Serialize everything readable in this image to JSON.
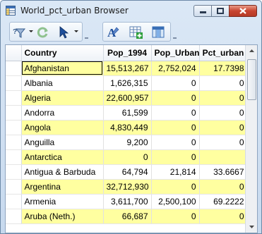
{
  "window": {
    "title": "World_pct_urban Browser",
    "icon": "table-browser-icon"
  },
  "toolbar": {
    "buttons": [
      {
        "name": "select-by-attribute-icon",
        "has_dropdown": true
      },
      {
        "name": "refresh-icon",
        "has_dropdown": false
      },
      {
        "name": "pointer-select-icon",
        "has_dropdown": true
      },
      {
        "name": "font-style-icon",
        "has_dropdown": false
      },
      {
        "name": "add-row-icon",
        "has_dropdown": false
      },
      {
        "name": "column-picker-icon",
        "has_dropdown": false
      }
    ]
  },
  "table": {
    "columns": [
      "Country",
      "Pop_1994",
      "Pop_Urban",
      "Pct_urban"
    ],
    "rows": [
      {
        "country": "Afghanistan",
        "pop_1994": "15,513,267",
        "pop_urban": "2,752,024",
        "pct_urban": "17.7398",
        "highlight": true,
        "selected": true
      },
      {
        "country": "Albania",
        "pop_1994": "1,626,315",
        "pop_urban": "0",
        "pct_urban": "0",
        "highlight": false
      },
      {
        "country": "Algeria",
        "pop_1994": "22,600,957",
        "pop_urban": "0",
        "pct_urban": "0",
        "highlight": true
      },
      {
        "country": "Andorra",
        "pop_1994": "61,599",
        "pop_urban": "0",
        "pct_urban": "0",
        "highlight": false
      },
      {
        "country": "Angola",
        "pop_1994": "4,830,449",
        "pop_urban": "0",
        "pct_urban": "0",
        "highlight": true
      },
      {
        "country": "Anguilla",
        "pop_1994": "9,200",
        "pop_urban": "0",
        "pct_urban": "0",
        "highlight": false
      },
      {
        "country": "Antarctica",
        "pop_1994": "0",
        "pop_urban": "0",
        "pct_urban": "",
        "highlight": true
      },
      {
        "country": "Antigua & Barbuda",
        "pop_1994": "64,794",
        "pop_urban": "21,814",
        "pct_urban": "33.6667",
        "highlight": false
      },
      {
        "country": "Argentina",
        "pop_1994": "32,712,930",
        "pop_urban": "0",
        "pct_urban": "0",
        "highlight": true
      },
      {
        "country": "Armenia",
        "pop_1994": "3,611,700",
        "pop_urban": "2,500,100",
        "pct_urban": "69.2222",
        "highlight": false
      },
      {
        "country": "Aruba (Neth.)",
        "pop_1994": "66,687",
        "pop_urban": "0",
        "pct_urban": "0",
        "highlight": true
      }
    ]
  },
  "colors": {
    "highlight_row": "#ffffa0",
    "window_frame": "#c7d9ee",
    "close_button": "#c84530"
  }
}
